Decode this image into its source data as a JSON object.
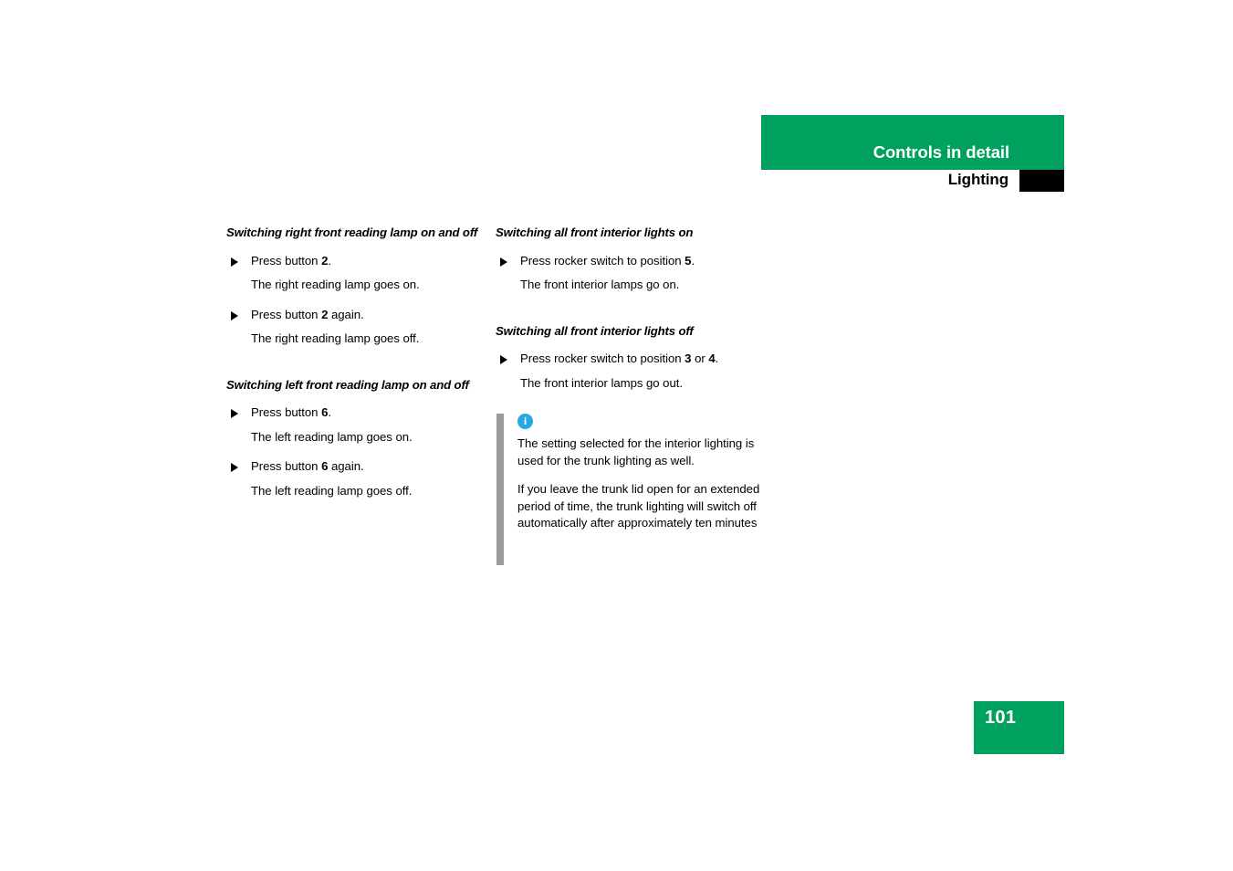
{
  "header": {
    "title": "Controls in detail",
    "subtitle": "Lighting",
    "green_color": "#00a05f",
    "black_tab_color": "#000000"
  },
  "left_column": {
    "sections": [
      {
        "heading": "Switching right front reading lamp on and off",
        "steps": [
          {
            "bullet_icon": "triangle-right-icon",
            "text_before": "Press button ",
            "emphasis": "2",
            "text_after": ".",
            "result": "The right reading lamp goes on."
          },
          {
            "bullet_icon": "triangle-right-icon",
            "text_before": "Press button ",
            "emphasis": "2",
            "text_after": " again.",
            "result": "The right reading lamp goes off."
          }
        ]
      },
      {
        "heading": "Switching left front reading lamp on and off",
        "steps": [
          {
            "bullet_icon": "triangle-right-icon",
            "text_before": "Press button ",
            "emphasis": "6",
            "text_after": ".",
            "result": "The left reading lamp goes on."
          },
          {
            "bullet_icon": "triangle-right-icon",
            "text_before": "Press button ",
            "emphasis": "6",
            "text_after": " again.",
            "result": "The left reading lamp goes off."
          }
        ]
      }
    ]
  },
  "right_column": {
    "sections": [
      {
        "heading": "Switching all front interior lights on",
        "steps": [
          {
            "bullet_icon": "triangle-right-icon",
            "text_before": "Press rocker switch to position ",
            "emphasis": "5",
            "text_after": ".",
            "result": "The front interior lamps go on."
          }
        ]
      },
      {
        "heading": "Switching all front interior lights off",
        "steps": [
          {
            "bullet_icon": "triangle-right-icon",
            "text_before": "Press rocker switch to position ",
            "emphasis": "3",
            "text_middle": " or ",
            "emphasis2": "4",
            "text_after": ".",
            "result": "The front interior lamps go out."
          }
        ]
      }
    ],
    "note": {
      "icon": "info-icon",
      "icon_glyph": "i",
      "icon_color": "#29a8e0",
      "bar_color": "#9a9a9a",
      "paragraphs": [
        "The setting selected for the interior lighting is used for the trunk lighting as well.",
        "If you leave the trunk lid open for an extended period of time, the trunk lighting will switch off automatically after approximately ten minutes"
      ]
    }
  },
  "footer": {
    "page_number": "101",
    "box_color": "#00a05f"
  }
}
